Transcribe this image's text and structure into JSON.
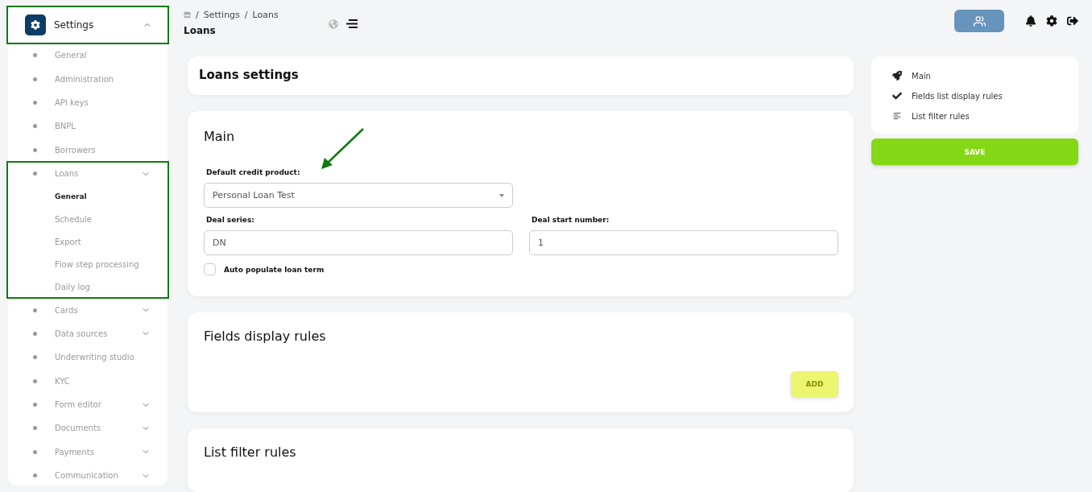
{
  "sidebar": {
    "header": {
      "label": "Settings",
      "expanded": true,
      "highlighted": true
    },
    "items": [
      {
        "label": "General",
        "expandable": false,
        "highlighted": false
      },
      {
        "label": "Administration",
        "expandable": false,
        "highlighted": false
      },
      {
        "label": "API keys",
        "expandable": false,
        "highlighted": false
      },
      {
        "label": "BNPL",
        "expandable": false,
        "highlighted": false
      },
      {
        "label": "Borrowers",
        "expandable": false,
        "highlighted": false
      },
      {
        "label": "Loans",
        "expandable": true,
        "highlighted": true,
        "children": [
          {
            "label": "General",
            "selected": true
          },
          {
            "label": "Schedule",
            "selected": false
          },
          {
            "label": "Export",
            "selected": false
          },
          {
            "label": "Flow step processing",
            "selected": false
          },
          {
            "label": "Daily log",
            "selected": false
          }
        ]
      },
      {
        "label": "Cards",
        "expandable": true,
        "highlighted": false
      },
      {
        "label": "Data sources",
        "expandable": true,
        "highlighted": false
      },
      {
        "label": "Underwriting studio",
        "expandable": false,
        "highlighted": false
      },
      {
        "label": "KYC",
        "expandable": false,
        "highlighted": false
      },
      {
        "label": "Form editor",
        "expandable": true,
        "highlighted": false
      },
      {
        "label": "Documents",
        "expandable": true,
        "highlighted": false
      },
      {
        "label": "Payments",
        "expandable": true,
        "highlighted": false
      },
      {
        "label": "Communication",
        "expandable": true,
        "highlighted": false
      }
    ]
  },
  "breadcrumb": {
    "separator": "/",
    "items": [
      "Settings",
      "Loans"
    ],
    "title": "Loans"
  },
  "page_title": "Loans settings",
  "main": {
    "title": "Main",
    "default_credit_product": {
      "label": "Default credit product:",
      "value": "Personal Loan Test"
    },
    "deal_series": {
      "label": "Deal series:",
      "value": "DN"
    },
    "deal_start_number": {
      "label": "Deal start number:",
      "value": "1"
    },
    "auto_populate": {
      "label": "Auto populate loan term",
      "checked": false
    }
  },
  "fields_display_rules": {
    "title": "Fields display rules",
    "add_button": "ADD"
  },
  "list_filter_rules": {
    "title": "List filter rules"
  },
  "nav": {
    "items": [
      {
        "kind": "rocket",
        "label": "Main"
      },
      {
        "kind": "check",
        "label": "Fields list display rules"
      },
      {
        "kind": "lines",
        "label": "List filter rules"
      }
    ],
    "save_button": "SAVE"
  }
}
